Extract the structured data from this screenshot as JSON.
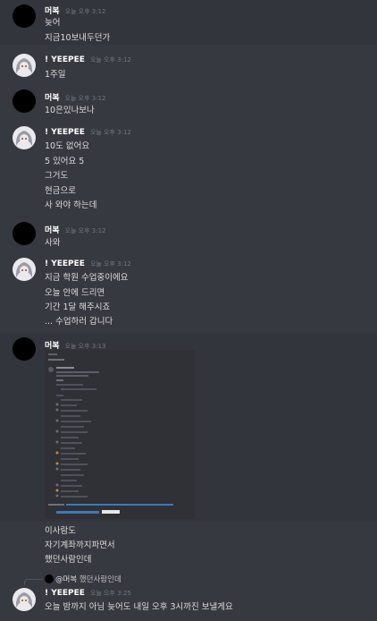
{
  "users": {
    "a": "머복",
    "b": "! YEEPEE"
  },
  "messages": [
    {
      "author": "머복",
      "time": "오늘 오후 3:12",
      "lines": [
        "늦어",
        "지금10보내두던가"
      ]
    },
    {
      "author": "! YEEPEE",
      "time": "오늘 오후 3:12",
      "lines": [
        "1주일"
      ]
    },
    {
      "author": "머복",
      "time": "오늘 오후 3:12",
      "lines": [
        "10은있나보나"
      ]
    },
    {
      "author": "! YEEPEE",
      "time": "오늘 오후 3:12",
      "lines": [
        "10도 없어요",
        "5 있어요 5",
        "그거도",
        "현금으로",
        "사 와야 하는데"
      ]
    },
    {
      "author": "머복",
      "time": "오늘 오후 3:12",
      "lines": [
        "사와"
      ]
    },
    {
      "author": "! YEEPEE",
      "time": "오늘 오후 3:12",
      "lines": [
        "지금 학원 수업중이에요",
        "오늘 안에 드리면",
        "기간 1달 해주시죠",
        "... 수업하러 갑니다"
      ]
    },
    {
      "author": "머복",
      "time": "오늘 오후 3:13",
      "lines": [
        "이사람도",
        "자기계좌까지파면서",
        "했던사람인데"
      ]
    },
    {
      "author": "! YEEPEE",
      "time": "오늘 오후 3:25",
      "reply": {
        "mention": "@머복",
        "text": "했던사람인데"
      },
      "lines": [
        "오늘 밤까지 아님 늦어도 내일 오후 3시까진 보낼게요"
      ]
    }
  ],
  "colors": {
    "background": "#36393f",
    "highlight": "#32353b",
    "name": "#ffffff",
    "timestamp": "#72767d",
    "text": "#dcddde"
  },
  "icons": {
    "avatar_a": "black-circle-avatar",
    "avatar_b": "anime-character-avatar"
  }
}
